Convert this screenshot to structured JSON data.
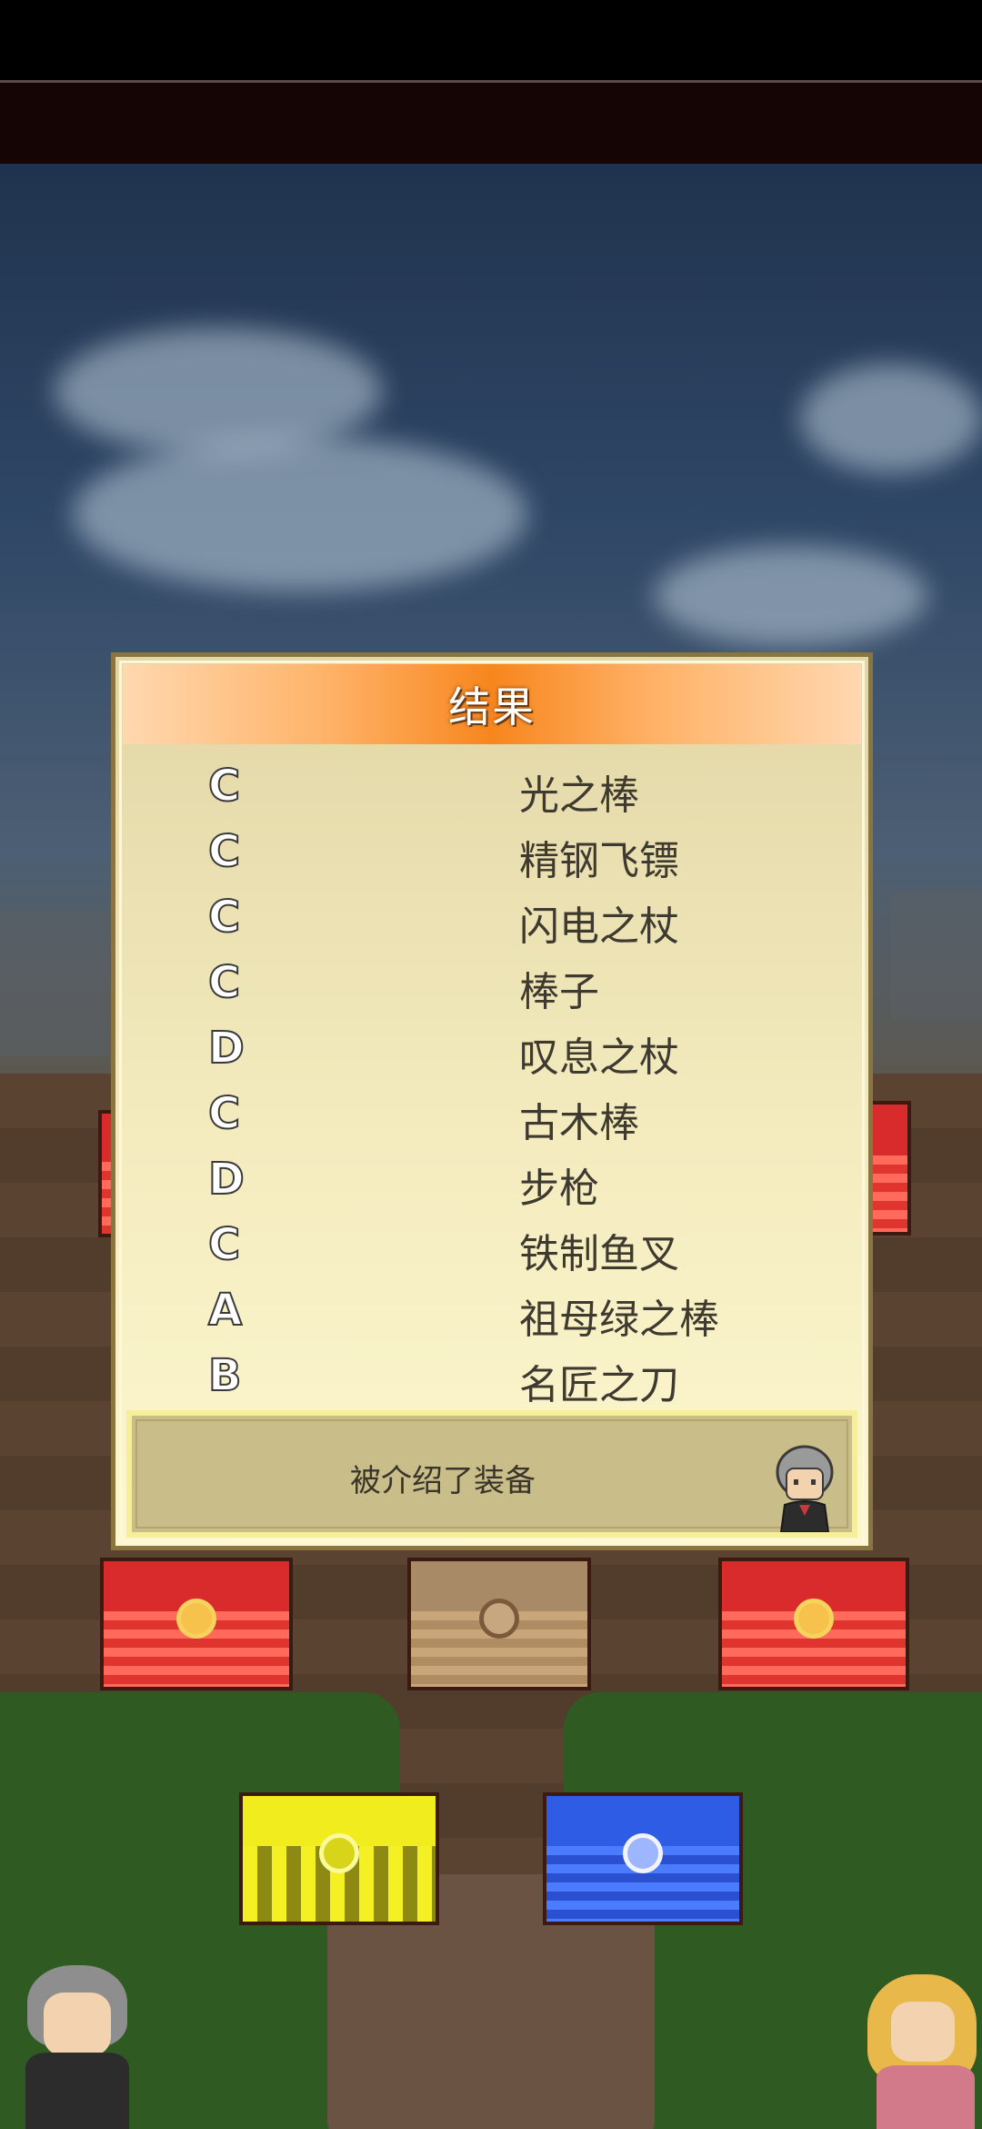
{
  "dialog": {
    "title": "结果",
    "results": [
      {
        "grade": "C",
        "item": "光之棒"
      },
      {
        "grade": "C",
        "item": "精钢飞镖"
      },
      {
        "grade": "C",
        "item": "闪电之杖"
      },
      {
        "grade": "C",
        "item": "棒子"
      },
      {
        "grade": "D",
        "item": "叹息之杖"
      },
      {
        "grade": "C",
        "item": "古木棒"
      },
      {
        "grade": "D",
        "item": "步枪"
      },
      {
        "grade": "C",
        "item": "铁制鱼叉"
      },
      {
        "grade": "A",
        "item": "祖母绿之棒"
      },
      {
        "grade": "B",
        "item": "名匠之刀"
      }
    ],
    "message": "被介绍了装备",
    "npc_icon": "gray-haired-clerk"
  },
  "scene": {
    "chests": [
      "red-chest-icon",
      "wooden-chest-icon",
      "red-chest-icon",
      "gold-chest-icon",
      "blue-chest-icon"
    ],
    "characters": [
      "gray-haired-man",
      "blonde-girl"
    ]
  }
}
